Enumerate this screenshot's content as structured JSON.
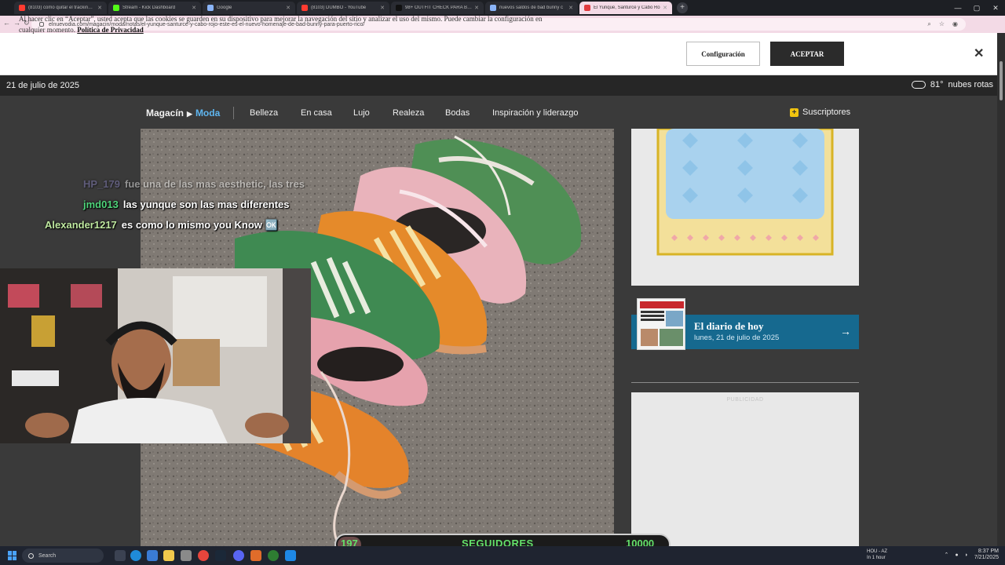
{
  "browser": {
    "tabs": [
      {
        "title": "(8103) como quitar el tracking ta",
        "color": "#ff3b30"
      },
      {
        "title": "Stream - Kick Dashboard",
        "color": "#53fc18"
      },
      {
        "title": "Google",
        "color": "#8ab4f8"
      },
      {
        "title": "(8103) DUMBO - YouTube",
        "color": "#ff3b30"
      },
      {
        "title": "98+ OUTFIT CHECK PARA BAD",
        "color": "#222222"
      },
      {
        "title": "nuevos saldos de bad bunny c",
        "color": "#8ab4f8"
      },
      {
        "title": "El Yunque, Santurce y Cabo Ro",
        "color": "#e03a3e"
      }
    ],
    "url": "elnuevodia.com/magacin/moda/notas/el-yunque-santurce-y-cabo-rojo-este-es-el-nuevo-homenaje-de-bad-bunny-para-puerto-rico/"
  },
  "cookie_banner": {
    "text": "Al hacer clic en “Aceptar”, usted acepta que las cookies se guarden en su dispositivo para mejorar la navegación del sitio y analizar el uso del mismo. Puede cambiar la configuración en cualquier momento.",
    "policy_link": "Política de Privacidad",
    "config_label": "Configuración",
    "accept_label": "ACEPTAR",
    "close_label": "✕"
  },
  "topbar": {
    "date": "21 de julio de 2025",
    "temperature": "81°",
    "condition": "nubes rotas"
  },
  "nav": {
    "brand": "Magacín",
    "separator": "▶",
    "section": "Moda",
    "items": [
      "Belleza",
      "En casa",
      "Lujo",
      "Realeza",
      "Bodas",
      "Inspiración y liderazgo"
    ],
    "subscribers": "Suscriptores"
  },
  "sidebar": {
    "diario_title": "El diario de hoy",
    "diario_date": "lunes, 21 de julio de 2025",
    "ad_label": "PUBLICIDAD"
  },
  "chat": [
    {
      "user": "HP_179",
      "message": "fue una de las mas aesthetic, las tres",
      "user_color": "#8d86c9",
      "faded": true
    },
    {
      "user": "jmd013",
      "message": "las yunque son las mas diferentes",
      "user_color": "#4fd47a",
      "faded": false
    },
    {
      "user": "Alexander1217",
      "message": "es como lo mismo you Know 🆗",
      "user_color": "#bfe9a0",
      "faded": false
    }
  ],
  "follower_goal": {
    "current": "197",
    "label": "SEGUIDORES",
    "goal": "10000",
    "progress_fraction": 0.0197
  },
  "taskbar": {
    "search": "Search",
    "weather_location": "HOU - AZ",
    "weather_note": "In 1 hour",
    "time": "8:37 PM",
    "date": "7/21/2025"
  }
}
